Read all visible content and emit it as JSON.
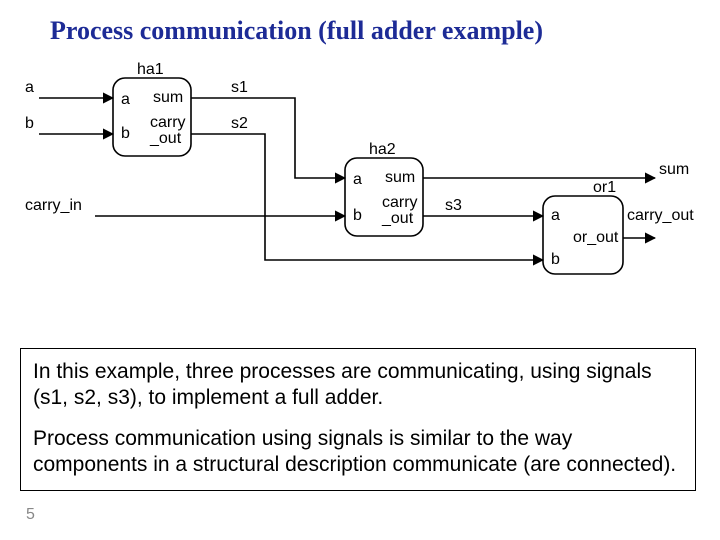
{
  "title": "Process communication (full adder example)",
  "inputs": {
    "a": "a",
    "b": "b",
    "carry_in": "carry_in"
  },
  "outputs": {
    "sum": "sum",
    "carry_out": "carry_out"
  },
  "blocks": {
    "ha1": {
      "name": "ha1",
      "a": "a",
      "b": "b",
      "sum": "sum",
      "carry_out": "carry\n_out"
    },
    "ha2": {
      "name": "ha2",
      "a": "a",
      "b": "b",
      "sum": "sum",
      "carry_out": "carry\n_out"
    },
    "or1": {
      "name": "or1",
      "a": "a",
      "b": "b",
      "or_out": "or_out"
    }
  },
  "signals": {
    "s1": "s1",
    "s2": "s2",
    "s3": "s3"
  },
  "textbox": {
    "p1": "In this example, three processes are communicating, using signals (s1, s2, s3), to implement a full adder.",
    "p2": "Process communication using signals is similar to the way components in a structural description communicate (are connected)."
  },
  "page_num": "5"
}
